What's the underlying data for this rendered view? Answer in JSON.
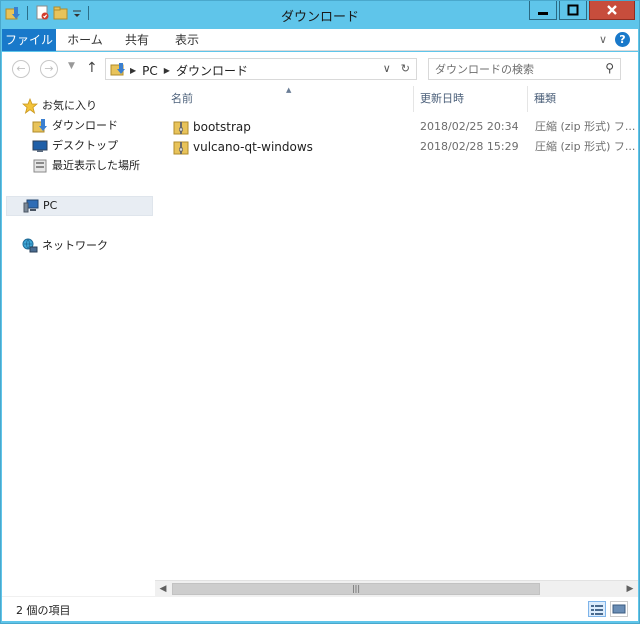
{
  "window": {
    "title": "ダウンロード",
    "accent": "#5fc5ea"
  },
  "ribbon": {
    "tabs": [
      {
        "label": "ファイル"
      },
      {
        "label": "ホーム"
      },
      {
        "label": "共有"
      },
      {
        "label": "表示"
      }
    ],
    "help": "?"
  },
  "address": {
    "crumbs": [
      "PC",
      "ダウンロード"
    ]
  },
  "search": {
    "placeholder": "ダウンロードの検索"
  },
  "nav": {
    "favorites": "お気に入り",
    "favorite_items": [
      {
        "label": "ダウンロード",
        "icon": "downloads-icon"
      },
      {
        "label": "デスクトップ",
        "icon": "desktop-icon"
      },
      {
        "label": "最近表示した場所",
        "icon": "recent-places-icon"
      }
    ],
    "pc": "PC",
    "network": "ネットワーク"
  },
  "columns": [
    {
      "label": "名前"
    },
    {
      "label": "更新日時"
    },
    {
      "label": "種類"
    }
  ],
  "files": [
    {
      "name": "bootstrap",
      "date": "2018/02/25 20:34",
      "type": "圧縮 (zip 形式) フ..."
    },
    {
      "name": "vulcano-qt-windows",
      "date": "2018/02/28 15:29",
      "type": "圧縮 (zip 形式) フ..."
    }
  ],
  "status": {
    "item_count": "2 個の項目"
  }
}
